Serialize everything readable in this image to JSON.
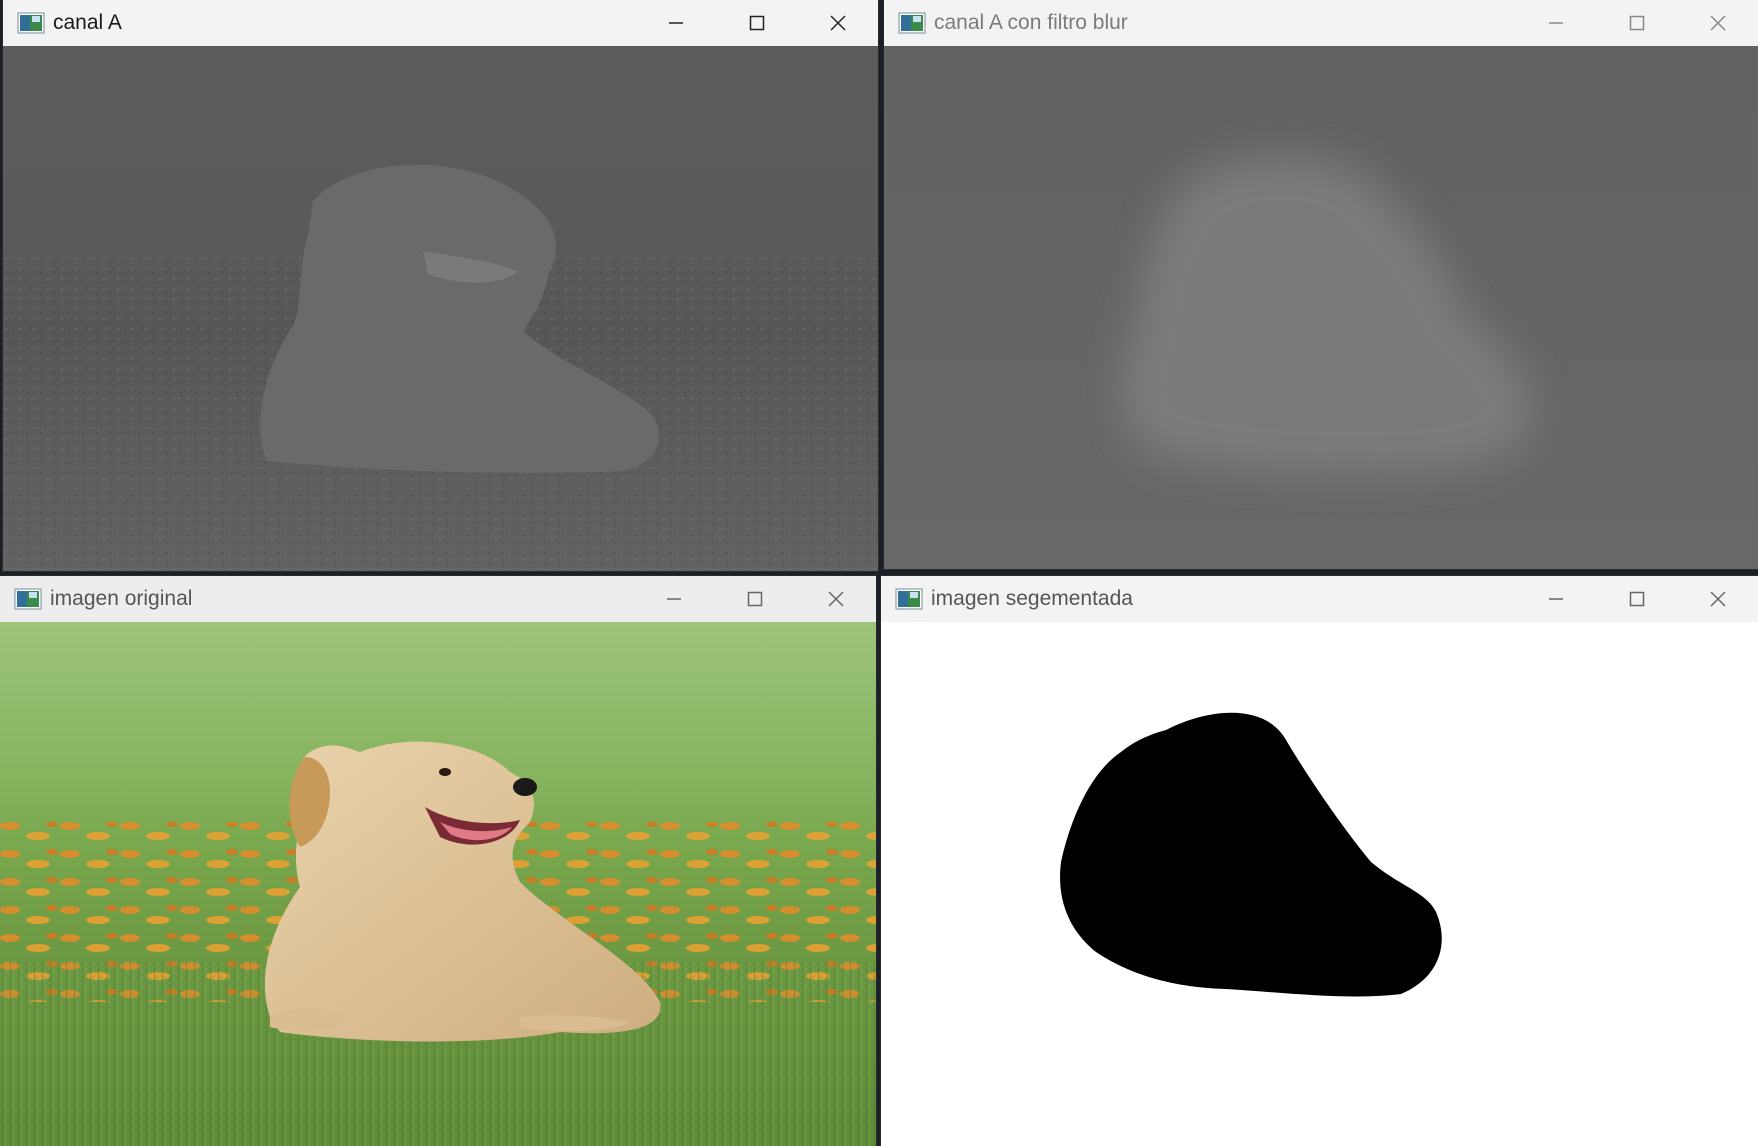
{
  "windows": {
    "canal_a": {
      "title": "canal A"
    },
    "canal_a_blur": {
      "title": "canal A con filtro blur"
    },
    "imagen_original": {
      "title": "imagen original"
    },
    "imagen_segmentada": {
      "title": "imagen segementada"
    }
  },
  "icons": {
    "app": "app-image-icon",
    "minimize": "minimize-icon",
    "maximize": "maximize-icon",
    "close": "close-icon"
  },
  "colors": {
    "titlebar": "#f3f3f3",
    "canal_gray": "#5f5f5f",
    "blur_gray": "#6b6b6b",
    "grass": "#6a9a4a",
    "segment_black": "#000000",
    "segment_white": "#ffffff"
  }
}
